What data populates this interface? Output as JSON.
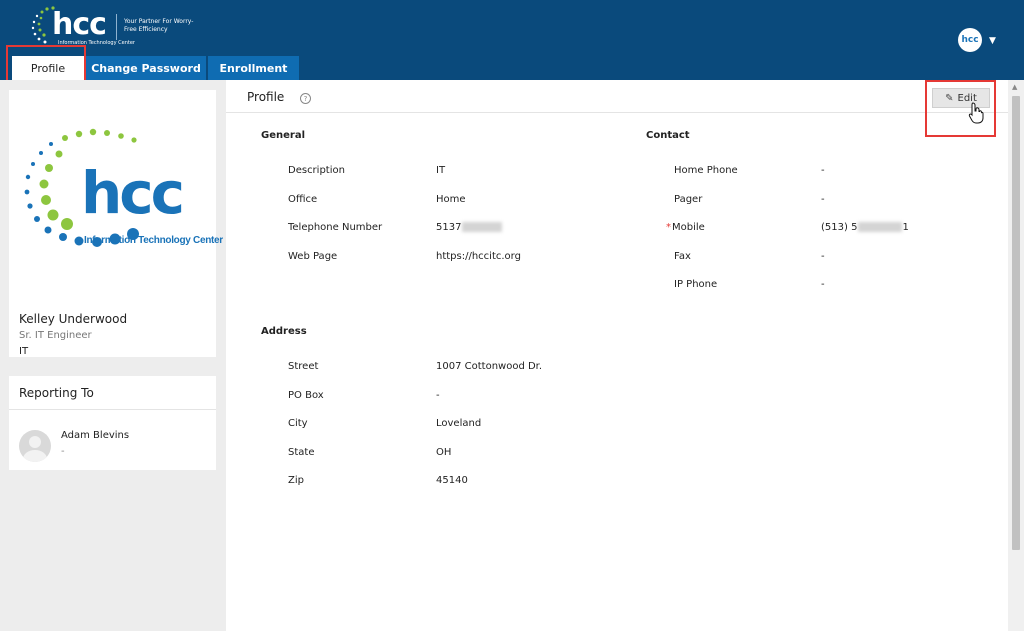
{
  "header": {
    "brand": "hcc",
    "brand_sub": "Information Technology Center",
    "tagline": "Your Partner For Worry-Free Efficiency",
    "user_avatar": "hcc"
  },
  "tabs": [
    {
      "label": "Profile",
      "active": true
    },
    {
      "label": "Change Password",
      "active": false
    },
    {
      "label": "Enrollment",
      "active": false
    }
  ],
  "profile_card": {
    "logo_word": "hcc",
    "logo_sub": "Information Technology Center",
    "name": "Kelley Underwood",
    "title": "Sr. IT Engineer",
    "dept": "IT"
  },
  "reporting": {
    "title": "Reporting To",
    "name": "Adam Blevins",
    "sub": "-"
  },
  "main": {
    "title": "Profile",
    "edit_label": "Edit"
  },
  "general": {
    "heading": "General",
    "fields": [
      {
        "label": "Description",
        "value": "IT"
      },
      {
        "label": "Office",
        "value": "Home"
      },
      {
        "label": "Telephone Number",
        "value": "5137"
      },
      {
        "label": "Web Page",
        "value": "https://hccitc.org"
      }
    ]
  },
  "contact": {
    "heading": "Contact",
    "fields": [
      {
        "label": "Home Phone",
        "value": "-"
      },
      {
        "label": "Pager",
        "value": "-"
      },
      {
        "label": "Mobile",
        "value": "(513) 5",
        "value_end": "1",
        "required": true
      },
      {
        "label": "Fax",
        "value": "-"
      },
      {
        "label": "IP Phone",
        "value": "-"
      }
    ]
  },
  "address": {
    "heading": "Address",
    "fields": [
      {
        "label": "Street",
        "value": "1007 Cottonwood Dr."
      },
      {
        "label": "PO Box",
        "value": "-"
      },
      {
        "label": "City",
        "value": "Loveland"
      },
      {
        "label": "State",
        "value": "OH"
      },
      {
        "label": "Zip",
        "value": "45140"
      }
    ]
  },
  "colors": {
    "header_bg": "#0a4a7c",
    "tab_bg": "#0f6cb2",
    "brand_blue": "#1a73b8",
    "brand_green": "#8dc63f",
    "highlight": "#e53935"
  }
}
